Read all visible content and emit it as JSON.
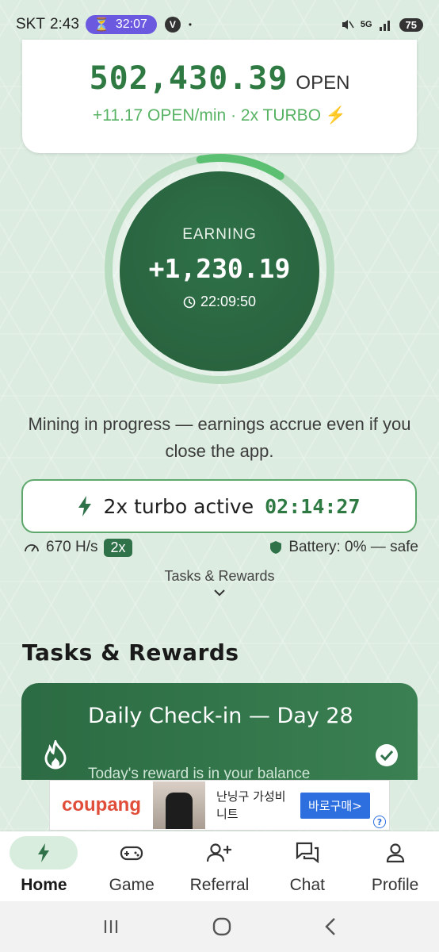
{
  "status_bar": {
    "carrier": "SKT",
    "time": "2:43",
    "timer": "32:07",
    "v_badge": "V",
    "dot": "•",
    "network": "5G",
    "battery": "75"
  },
  "balance": {
    "amount": "502,430.39",
    "unit": "OPEN",
    "rate_text": "+11.17 OPEN/min · 2x TURBO",
    "rate_icon": "bolt-icon"
  },
  "earning": {
    "label": "EARNING",
    "value": "+1,230.19",
    "elapsed": "22:09:50",
    "progress_fraction": 0.12
  },
  "mining_message": "Mining in progress — earnings accrue even if you close the app.",
  "turbo": {
    "label": "2x turbo active",
    "countdown": "02:14:27"
  },
  "stats": {
    "hashrate": "670 H/s",
    "multiplier": "2x",
    "battery_text": "Battery: 0% — safe"
  },
  "tasks_link": "Tasks & Rewards",
  "tasks_section": {
    "heading": "Tasks & Rewards",
    "checkin_title": "Daily Check-in — Day 28",
    "checkin_subtitle": "Today's reward is in your balance"
  },
  "ad": {
    "brand": "coupang",
    "product": "난닝구 가성비 니트",
    "cta": "바로구매>",
    "info": "?"
  },
  "nav": {
    "items": [
      {
        "label": "Home",
        "icon": "bolt-icon"
      },
      {
        "label": "Game",
        "icon": "gamepad-icon"
      },
      {
        "label": "Referral",
        "icon": "add-user-icon"
      },
      {
        "label": "Chat",
        "icon": "chat-icon"
      },
      {
        "label": "Profile",
        "icon": "profile-icon"
      }
    ]
  },
  "colors": {
    "accent": "#2f7148",
    "accent_light": "#57b363",
    "background": "#dcece0",
    "turbo_bolt": "#e8a53a"
  }
}
